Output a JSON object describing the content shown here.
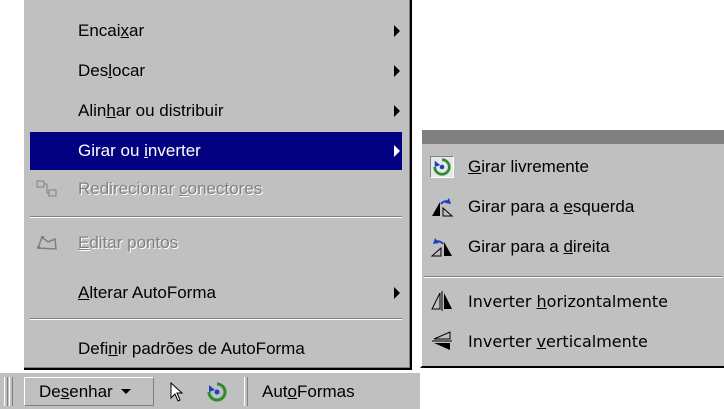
{
  "menu": {
    "items": [
      {
        "pre": "Encai",
        "acc": "x",
        "post": "ar"
      },
      {
        "pre": "Des",
        "acc": "l",
        "post": "ocar"
      },
      {
        "pre": "Alin",
        "acc": "h",
        "post": "ar ou distribuir"
      },
      {
        "pre": "Girar ou ",
        "acc": "i",
        "post": "nverter"
      },
      {
        "pre": "Redirecionar ",
        "acc": "c",
        "post": "onectores"
      },
      {
        "pre": "",
        "acc": "E",
        "post": "ditar pontos"
      },
      {
        "pre": "",
        "acc": "A",
        "post": "lterar AutoForma"
      },
      {
        "pre": "Defi",
        "acc": "n",
        "post": "ir padrões de AutoForma"
      }
    ]
  },
  "submenu": {
    "items": [
      {
        "pre": "",
        "acc": "G",
        "post": "irar livremente"
      },
      {
        "pre": "Girar para a ",
        "acc": "e",
        "post": "squerda"
      },
      {
        "pre": "Girar para a ",
        "acc": "d",
        "post": "ireita"
      },
      {
        "pre": "Inverter ",
        "acc": "h",
        "post": "orizontalmente"
      },
      {
        "pre": "Inverter ",
        "acc": "v",
        "post": "erticalmente"
      }
    ]
  },
  "toolbar": {
    "draw": {
      "pre": "De",
      "acc": "s",
      "post": "enhar"
    },
    "autoshapes": {
      "pre": "Aut",
      "acc": "o",
      "post": "Formas"
    }
  },
  "colors": {
    "highlight": "#000080",
    "menu_bg": "#c0c0c0",
    "rotate_green": "#2e8b2e",
    "rotate_blue": "#1f3fbf"
  }
}
